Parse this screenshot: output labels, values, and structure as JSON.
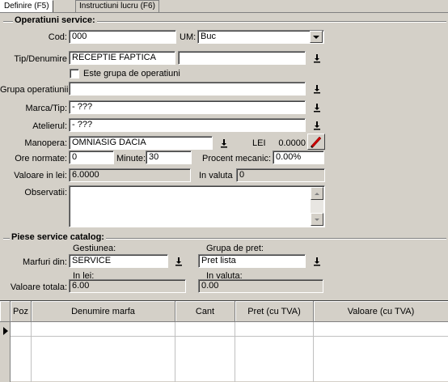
{
  "tabs": [
    {
      "label": "Definire (F5)",
      "active": true
    },
    {
      "label": "Instructiuni lucru (F6)",
      "active": false
    }
  ],
  "operatiuni": {
    "title": "Operatiuni service:",
    "cod_label": "Cod:",
    "cod_value": "000",
    "um_label": "UM:",
    "um_value": "Buc",
    "tip_label": "Tip/Denumire",
    "tip_value": "RECEPTIE FAPTICA",
    "tip_value2": "",
    "grupa_check_label": "Este grupa de operatiuni",
    "grupa_label": "Grupa operatiunii:",
    "grupa_value": "",
    "marca_label": "Marca/Tip:",
    "marca_value": "- ???",
    "atelier_label": "Atelierul:",
    "atelier_value": "- ???",
    "manopera_label": "Manopera:",
    "manopera_value": "OMNIASIG DACIA",
    "lei_label": "LEI",
    "lei_value": "0.0000",
    "ore_label": "Ore normate:",
    "ore_value": "0",
    "minute_label": "Minute:",
    "minute_value": "30",
    "procent_label": "Procent mecanic:",
    "procent_value": "0.00%",
    "valoare_lei_label": "Valoare in lei:",
    "valoare_lei_value": "6.0000",
    "in_valuta_label": "In valuta",
    "in_valuta_value": "0",
    "observatii_label": "Observatii:",
    "observatii_value": ""
  },
  "piese": {
    "title": "Piese service catalog:",
    "gestiunea_label": "Gestiunea:",
    "marfuri_label": "Marfuri din:",
    "marfuri_value": "SERVICE",
    "grupa_pret_label": "Grupa de pret:",
    "grupa_pret_value": "Pret lista",
    "valoare_totala_label": "Valoare totala:",
    "in_lei_label": "In lei:",
    "in_lei_value": "6.00",
    "in_valuta_label": "In valuta:",
    "in_valuta_value": "0.00"
  },
  "grid": {
    "columns": [
      "Poz",
      "Denumire marfa",
      "Cant",
      "Pret (cu TVA)",
      "Valoare (cu TVA)"
    ]
  },
  "colors": {
    "face": "#d4d0c8",
    "window": "#ffffff",
    "shadow": "#808080",
    "lei_icon": "#cc0000"
  },
  "icons": {
    "lookup": "download-arrow-icon",
    "combo": "chevron-down-icon",
    "lei": "red-pen-icon",
    "row_pointer": "triangle-right-icon"
  }
}
